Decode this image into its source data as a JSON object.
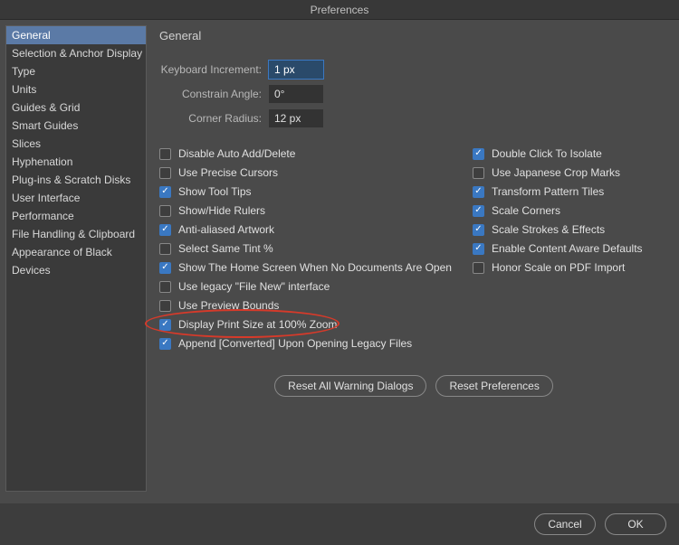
{
  "title": "Preferences",
  "sidebar": {
    "items": [
      {
        "label": "General",
        "selected": true
      },
      {
        "label": "Selection & Anchor Display"
      },
      {
        "label": "Type"
      },
      {
        "label": "Units"
      },
      {
        "label": "Guides & Grid"
      },
      {
        "label": "Smart Guides"
      },
      {
        "label": "Slices"
      },
      {
        "label": "Hyphenation"
      },
      {
        "label": "Plug-ins & Scratch Disks"
      },
      {
        "label": "User Interface"
      },
      {
        "label": "Performance"
      },
      {
        "label": "File Handling & Clipboard"
      },
      {
        "label": "Appearance of Black"
      },
      {
        "label": "Devices"
      }
    ]
  },
  "panel": {
    "heading": "General",
    "fields": {
      "keyboard_increment": {
        "label": "Keyboard Increment:",
        "value": "1 px"
      },
      "constrain_angle": {
        "label": "Constrain Angle:",
        "value": "0°"
      },
      "corner_radius": {
        "label": "Corner Radius:",
        "value": "12 px"
      }
    },
    "checks_left": [
      {
        "label": "Disable Auto Add/Delete",
        "checked": false
      },
      {
        "label": "Use Precise Cursors",
        "checked": false
      },
      {
        "label": "Show Tool Tips",
        "checked": true
      },
      {
        "label": "Show/Hide Rulers",
        "checked": false
      },
      {
        "label": "Anti-aliased Artwork",
        "checked": true
      },
      {
        "label": "Select Same Tint %",
        "checked": false
      },
      {
        "label": "Show The Home Screen When No Documents Are Open",
        "checked": true
      },
      {
        "label": "Use legacy \"File New\" interface",
        "checked": false
      },
      {
        "label": "Use Preview Bounds",
        "checked": false
      },
      {
        "label": "Display Print Size at 100% Zoom",
        "checked": true,
        "annotated": true
      },
      {
        "label": "Append [Converted] Upon Opening Legacy Files",
        "checked": true
      }
    ],
    "checks_right": [
      {
        "label": "Double Click To Isolate",
        "checked": true
      },
      {
        "label": "Use Japanese Crop Marks",
        "checked": false
      },
      {
        "label": "Transform Pattern Tiles",
        "checked": true
      },
      {
        "label": "Scale Corners",
        "checked": true
      },
      {
        "label": "Scale Strokes & Effects",
        "checked": true
      },
      {
        "label": "Enable Content Aware Defaults",
        "checked": true
      },
      {
        "label": "Honor Scale on PDF Import",
        "checked": false
      }
    ],
    "buttons": {
      "reset_warnings": "Reset All Warning Dialogs",
      "reset_prefs": "Reset Preferences"
    }
  },
  "footer": {
    "cancel": "Cancel",
    "ok": "OK"
  },
  "colors": {
    "accent": "#3a78c2",
    "annotation": "#d63a2a"
  }
}
